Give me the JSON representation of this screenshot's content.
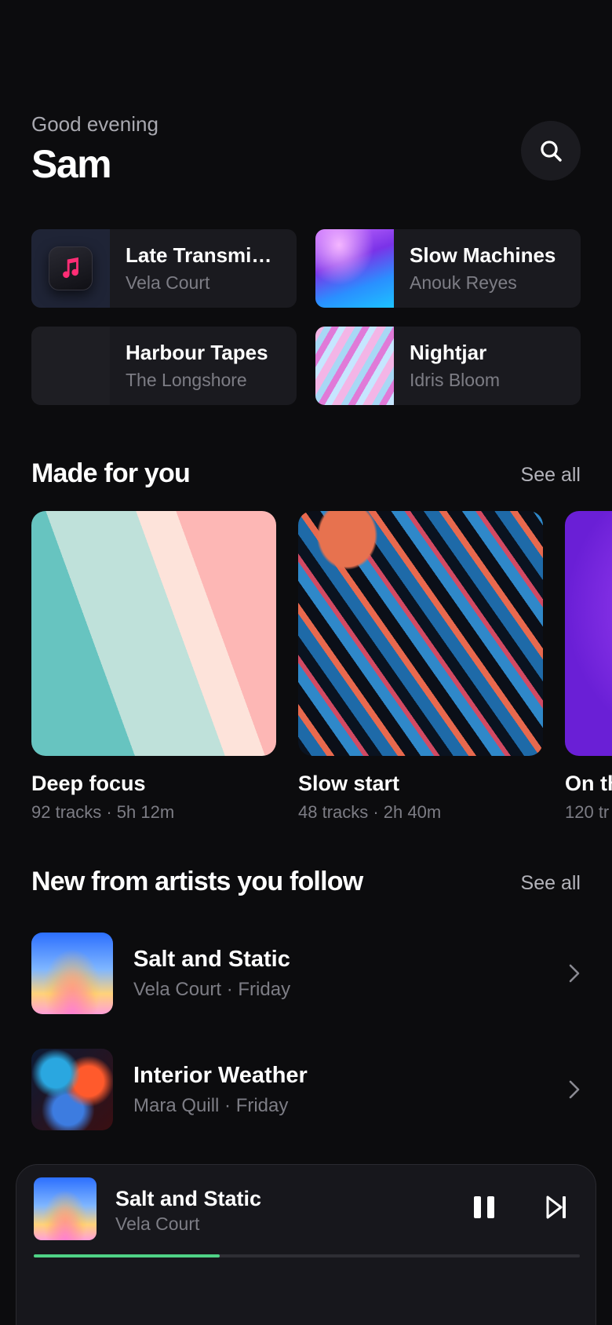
{
  "header": {
    "greeting": "Good evening",
    "username": "Sam"
  },
  "quick_tiles": [
    {
      "title": "Late Transmissions",
      "subtitle": "Vela Court"
    },
    {
      "title": "Slow Machines",
      "subtitle": "Anouk Reyes"
    },
    {
      "title": "Harbour Tapes",
      "subtitle": "The Longshore"
    },
    {
      "title": "Nightjar",
      "subtitle": "Idris Bloom"
    }
  ],
  "made_for_you": {
    "title": "Made for you",
    "see_all": "See all",
    "cards": [
      {
        "title": "Deep focus",
        "subtitle": "92 tracks · 5h 12m"
      },
      {
        "title": "Slow start",
        "subtitle": "48 tracks · 2h 40m"
      },
      {
        "title": "On th",
        "subtitle": "120 tr"
      }
    ]
  },
  "new_releases": {
    "title": "New from artists you follow",
    "see_all": "See all",
    "items": [
      {
        "title": "Salt and Static",
        "subtitle": "Vela Court · Friday"
      },
      {
        "title": "Interior Weather",
        "subtitle": "Mara Quill · Friday"
      }
    ]
  },
  "now_playing": {
    "title": "Salt and Static",
    "artist": "Vela Court",
    "progress": 0.34,
    "accent": "#4fd286"
  }
}
